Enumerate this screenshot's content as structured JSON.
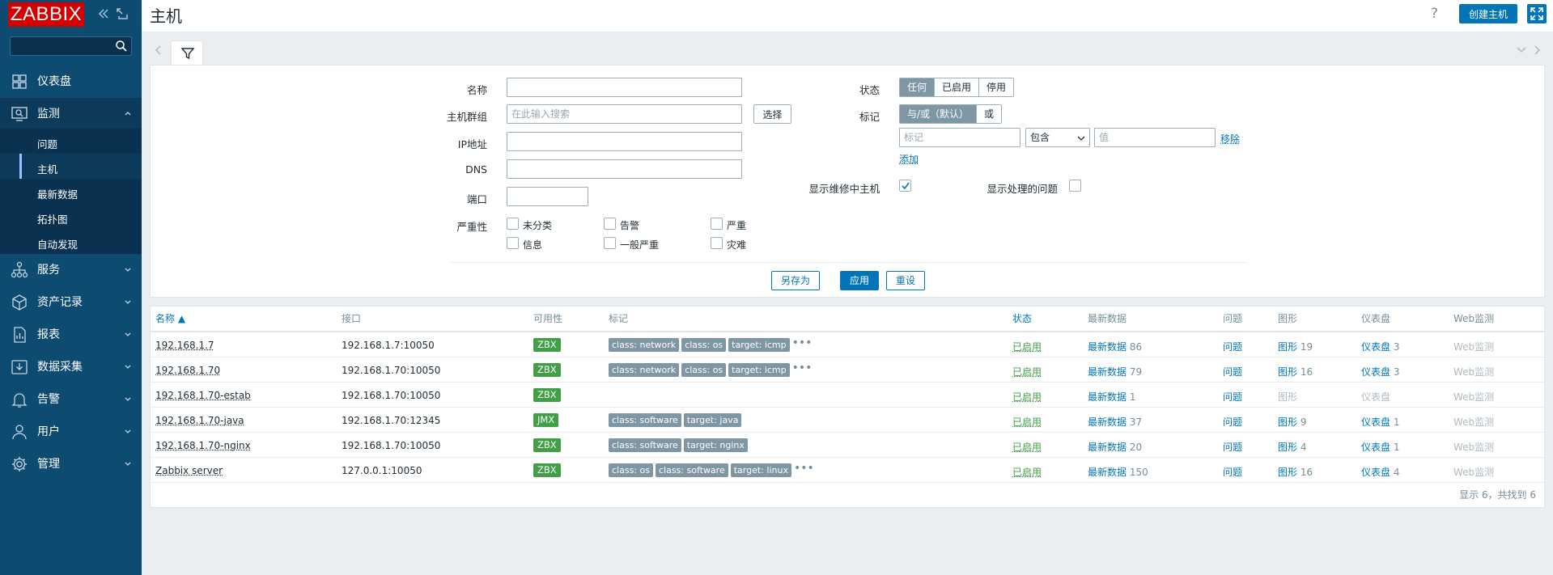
{
  "sidebar": {
    "logo": "ZABBIX",
    "search_placeholder": "",
    "nav": [
      {
        "key": "dashboards",
        "label": "仪表盘"
      },
      {
        "key": "monitoring",
        "label": "监测"
      },
      {
        "key": "services",
        "label": "服务"
      },
      {
        "key": "inventory",
        "label": "资产记录"
      },
      {
        "key": "reports",
        "label": "报表"
      },
      {
        "key": "datacollection",
        "label": "数据采集"
      },
      {
        "key": "alerts",
        "label": "告警"
      },
      {
        "key": "users",
        "label": "用户"
      },
      {
        "key": "administration",
        "label": "管理"
      }
    ],
    "monitoring_sub": [
      {
        "label": "问题"
      },
      {
        "label": "主机"
      },
      {
        "label": "最新数据"
      },
      {
        "label": "拓扑图"
      },
      {
        "label": "自动发现"
      }
    ]
  },
  "header": {
    "title": "主机",
    "help": "?",
    "create_button": "创建主机"
  },
  "filter": {
    "name_label": "名称",
    "name_value": "",
    "hostgroups_label": "主机群组",
    "hostgroups_placeholder": "在此输入搜索",
    "select_button": "选择",
    "ip_label": "IP地址",
    "ip_value": "",
    "dns_label": "DNS",
    "dns_value": "",
    "port_label": "端口",
    "port_value": "",
    "severity_label": "严重性",
    "severities": [
      "未分类",
      "告警",
      "严重",
      "信息",
      "一般严重",
      "灾难"
    ],
    "status_label": "状态",
    "status_options": [
      "任何",
      "已启用",
      "停用"
    ],
    "status_selected": "任何",
    "tags_label": "标记",
    "tags_operator_options": [
      "与/或（默认）",
      "或"
    ],
    "tags_operator_selected": "与/或（默认）",
    "tag_name_placeholder": "标记",
    "tag_operator_value": "包含",
    "tag_value_placeholder": "值",
    "remove_link": "移除",
    "add_link": "添加",
    "show_maintenance_label": "显示维修中主机",
    "show_maintenance_checked": true,
    "show_suppressed_label": "显示处理的问题",
    "show_suppressed_checked": false,
    "save_as_button": "另存为",
    "apply_button": "应用",
    "reset_button": "重设"
  },
  "table": {
    "columns": {
      "name": "名称 ▲",
      "interface": "接口",
      "availability": "可用性",
      "tags": "标记",
      "status": "状态",
      "latest_data": "最新数据",
      "problems": "问题",
      "graphs": "图形",
      "dashboards": "仪表盘",
      "web": "Web监测"
    },
    "rows": [
      {
        "name": "192.168.1.7",
        "interface": "192.168.1.7:10050",
        "availability": "ZBX",
        "tags": [
          "class: network",
          "class: os",
          "target: icmp"
        ],
        "more": "•••",
        "status": "已启用",
        "latest": "最新数据",
        "latest_count": "86",
        "problems": "问题",
        "graphs": "图形",
        "graphs_count": "19",
        "dash": "仪表盘",
        "dash_count": "3",
        "web": "Web监测"
      },
      {
        "name": "192.168.1.70",
        "interface": "192.168.1.70:10050",
        "availability": "ZBX",
        "tags": [
          "class: network",
          "class: os",
          "target: icmp"
        ],
        "more": "•••",
        "status": "已启用",
        "latest": "最新数据",
        "latest_count": "79",
        "problems": "问题",
        "graphs": "图形",
        "graphs_count": "16",
        "dash": "仪表盘",
        "dash_count": "3",
        "web": "Web监测"
      },
      {
        "name": "192.168.1.70-estab",
        "interface": "192.168.1.70:10050",
        "availability": "ZBX",
        "tags": [],
        "more": "",
        "status": "已启用",
        "latest": "最新数据",
        "latest_count": "1",
        "problems": "问题",
        "graphs": "图形",
        "graphs_count": "",
        "dash": "仪表盘",
        "dash_count": "",
        "web": "Web监测"
      },
      {
        "name": "192.168.1.70-java",
        "interface": "192.168.1.70:12345",
        "availability": "JMX",
        "tags": [
          "class: software",
          "target: java"
        ],
        "more": "",
        "status": "已启用",
        "latest": "最新数据",
        "latest_count": "37",
        "problems": "问题",
        "graphs": "图形",
        "graphs_count": "9",
        "dash": "仪表盘",
        "dash_count": "1",
        "web": "Web监测"
      },
      {
        "name": "192.168.1.70-nginx",
        "interface": "192.168.1.70:10050",
        "availability": "ZBX",
        "tags": [
          "class: software",
          "target: nginx"
        ],
        "more": "",
        "status": "已启用",
        "latest": "最新数据",
        "latest_count": "20",
        "problems": "问题",
        "graphs": "图形",
        "graphs_count": "4",
        "dash": "仪表盘",
        "dash_count": "1",
        "web": "Web监测"
      },
      {
        "name": "Zabbix server",
        "interface": "127.0.0.1:10050",
        "availability": "ZBX",
        "tags": [
          "class: os",
          "class: software",
          "target: linux"
        ],
        "more": "•••",
        "status": "已启用",
        "latest": "最新数据",
        "latest_count": "150",
        "problems": "问题",
        "graphs": "图形",
        "graphs_count": "16",
        "dash": "仪表盘",
        "dash_count": "4",
        "web": "Web监测"
      }
    ],
    "footer": "显示 6，共找到 6"
  },
  "colors": {
    "sidebar_bg": "#0e4b71",
    "accent": "#0275b8",
    "logo_red": "#d40000",
    "status_green": "#429e47",
    "tag_grey": "#7f97a4"
  }
}
